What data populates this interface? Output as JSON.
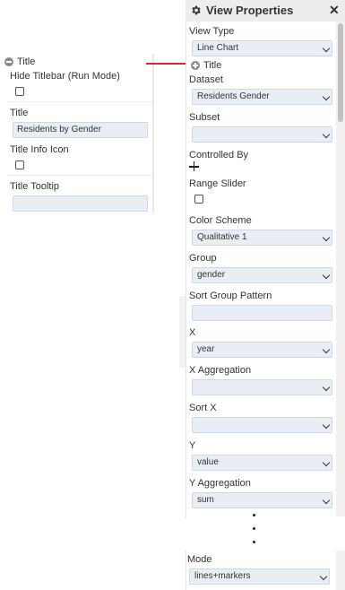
{
  "zoom_section": {
    "section_title": "Title",
    "fields": {
      "hide_titlebar_label": "Hide Titlebar (Run Mode)",
      "title_label": "Title",
      "title_value": "Residents by Gender",
      "title_info_icon_label": "Title Info Icon",
      "title_tooltip_label": "Title Tooltip",
      "title_tooltip_value": ""
    }
  },
  "panel": {
    "title": "View Properties",
    "view_type_label": "View Type",
    "view_type_value": "Line Chart",
    "title_section_label": "Title",
    "dataset_label": "Dataset",
    "dataset_value": "Residents Gender",
    "subset_label": "Subset",
    "subset_value": "",
    "controlled_by_label": "Controlled By",
    "range_slider_label": "Range Slider",
    "color_scheme_label": "Color Scheme",
    "color_scheme_value": "Qualitative 1",
    "group_label": "Group",
    "group_value": "gender",
    "sort_group_pattern_label": "Sort Group Pattern",
    "sort_group_pattern_value": "",
    "x_label": "X",
    "x_value": "year",
    "x_aggregation_label": "X Aggregation",
    "x_aggregation_value": "",
    "sort_x_label": "Sort X",
    "sort_x_value": "",
    "y_label": "Y",
    "y_value": "value",
    "y_aggregation_label": "Y Aggregation",
    "y_aggregation_value": "sum"
  },
  "mode_panel": {
    "mode_label": "Mode",
    "mode_value": "lines+markers"
  },
  "icons": {
    "header": "gear-icon",
    "close": "close-icon",
    "collapse": "minus-circle-icon",
    "expand": "plus-circle-icon",
    "add": "plus-icon",
    "dropdown": "chevron-down-icon"
  },
  "colors": {
    "connector": "#d9262c",
    "input_bg": "#e8eef4",
    "header_bg": "#ededed"
  }
}
